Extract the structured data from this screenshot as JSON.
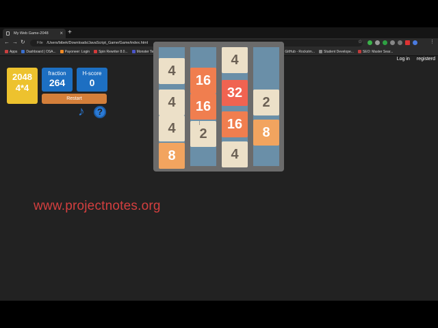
{
  "browser": {
    "tab_title": "My Web Game-2048",
    "new_tab_symbol": "+",
    "close_symbol": "×",
    "file_label": "File",
    "url": "/Users/bibek/Downloads/JavaScript_Game/Game/index.html",
    "bookmarks": [
      {
        "label": "Apps",
        "color": "#c94040"
      },
      {
        "label": "Dashboard | OSA...",
        "color": "#3a6fd0"
      },
      {
        "label": "Payoneer: Login",
        "color": "#f08a24"
      },
      {
        "label": "Spin Rewriter 8.0...",
        "color": "#d33a3a"
      },
      {
        "label": "Monster Techno",
        "color": "#4a55c9"
      },
      {
        "label": "Fiverr - Freelance...",
        "color": "#1dbf73"
      },
      {
        "label": "Webmail: Google...",
        "color": "#555555"
      },
      {
        "label": "Users' Interest As...",
        "color": "#7ab23b"
      },
      {
        "label": "GitHub - Rockstm...",
        "color": "#aaaaaa"
      },
      {
        "label": "Student Develope...",
        "color": "#888888"
      },
      {
        "label": "SEO: Master Sear...",
        "color": "#c23b3b"
      }
    ]
  },
  "auth": {
    "login": "Log in",
    "register": "registerd"
  },
  "logo": {
    "title": "2048",
    "size": "4*4"
  },
  "score": {
    "label": "fraction",
    "value": "264"
  },
  "hscore": {
    "label": "H-score",
    "value": "0"
  },
  "restart_label": "Restart",
  "icons": {
    "music": "music-note-icon",
    "help": "help-icon",
    "help_symbol": "?",
    "music_symbol": "♪"
  },
  "tiles": [
    {
      "value": "4",
      "kind": "t4"
    },
    {
      "value": "4",
      "kind": "t4"
    },
    {
      "value": "4",
      "kind": "t4"
    },
    {
      "value": "8",
      "kind": "t8"
    },
    {
      "value": "16",
      "kind": "t16"
    },
    {
      "value": "16",
      "kind": "t16"
    },
    {
      "value": "2",
      "kind": "t2"
    },
    {
      "value": "4",
      "kind": "t4"
    },
    {
      "value": "32",
      "kind": "t32"
    },
    {
      "value": "16",
      "kind": "t16"
    },
    {
      "value": "4",
      "kind": "t4"
    },
    {
      "value": "2",
      "kind": "t2"
    },
    {
      "value": "8",
      "kind": "t8"
    }
  ],
  "site_url": "www.projectnotes.org"
}
